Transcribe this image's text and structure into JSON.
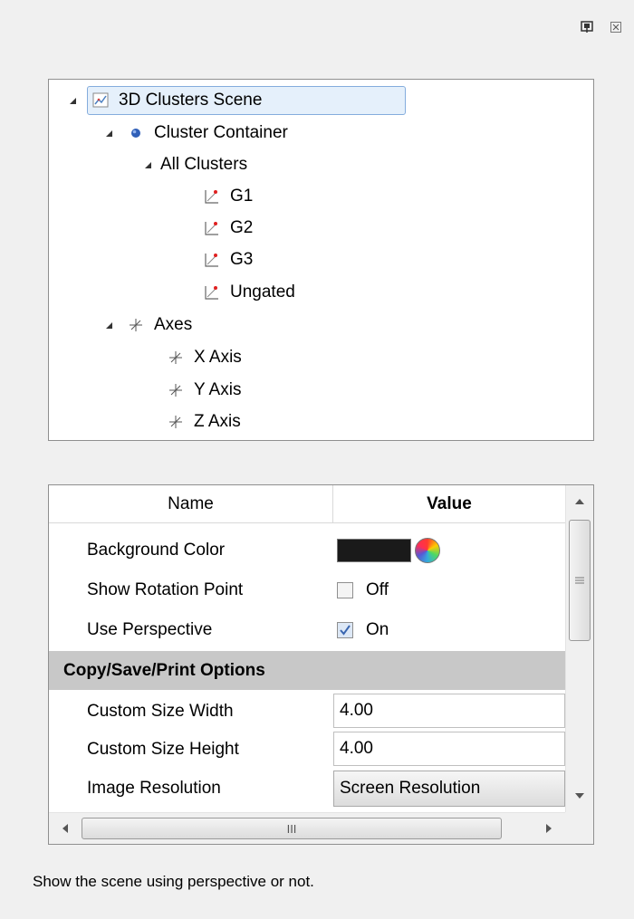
{
  "window": {
    "pin_icon": "pin-icon",
    "close_icon": "close-icon"
  },
  "tree": {
    "root": {
      "label": "3D Clusters Scene",
      "icon": "scene-chart-icon"
    },
    "cluster_container": {
      "label": "Cluster Container",
      "icon": "sphere-icon"
    },
    "all_clusters": {
      "label": "All Clusters"
    },
    "clusters": [
      {
        "label": "G1",
        "icon": "scatter-plot-icon"
      },
      {
        "label": "G2",
        "icon": "scatter-plot-icon"
      },
      {
        "label": "G3",
        "icon": "scatter-plot-icon"
      },
      {
        "label": "Ungated",
        "icon": "scatter-plot-icon"
      }
    ],
    "axes": {
      "label": "Axes",
      "icon": "axes-icon"
    },
    "axis_items": [
      {
        "label": "X Axis",
        "icon": "axes-icon"
      },
      {
        "label": "Y Axis",
        "icon": "axes-icon"
      },
      {
        "label": "Z Axis",
        "icon": "axes-icon"
      }
    ]
  },
  "grid": {
    "headers": {
      "name": "Name",
      "value": "Value"
    },
    "rows": {
      "background_color": {
        "name": "Background Color",
        "color": "#1a1a1a"
      },
      "show_rotation_point": {
        "name": "Show Rotation Point",
        "value": "Off",
        "checked": false
      },
      "use_perspective": {
        "name": "Use Perspective",
        "value": "On",
        "checked": true
      }
    },
    "section": "Copy/Save/Print Options",
    "options": {
      "custom_width": {
        "name": "Custom Size Width",
        "value": "4.00"
      },
      "custom_height": {
        "name": "Custom Size Height",
        "value": "4.00"
      },
      "image_resolution": {
        "name": "Image Resolution",
        "value": "Screen Resolution"
      }
    },
    "hscroll_grip": "III"
  },
  "description": "Show the scene using perspective or not."
}
